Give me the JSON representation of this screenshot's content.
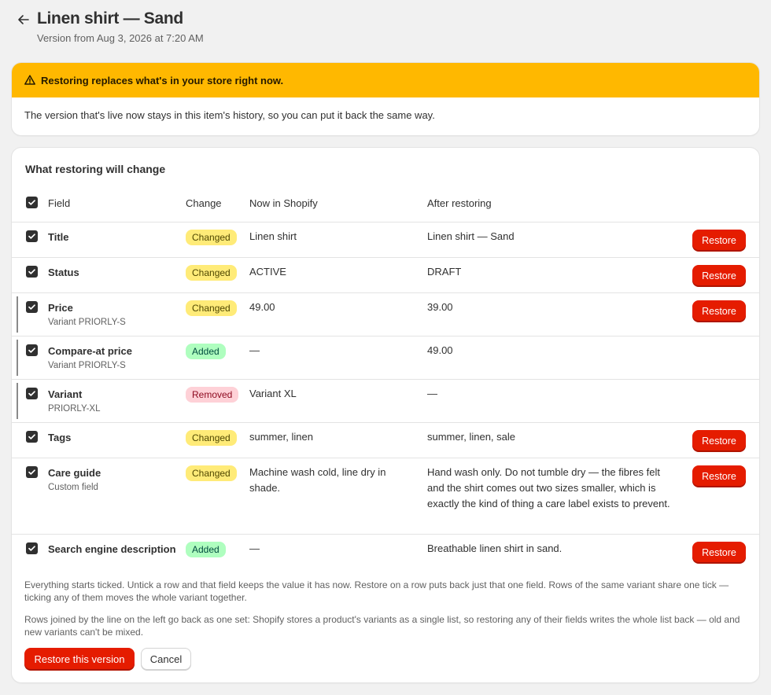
{
  "header": {
    "back_icon": "arrow-left-icon",
    "title": "Linen shirt — Sand",
    "subtitle": "Version from Aug 3, 2026 at 7:20 AM"
  },
  "banner": {
    "icon": "warning-triangle-icon",
    "color": "#ffb800",
    "title": "Restoring replaces what's in your store right now.",
    "body": "The version that's live now stays in this item's history, so you can put it back the same way."
  },
  "changes": {
    "title": "What restoring will change",
    "columns": {
      "field": "Field",
      "change": "Change",
      "now": "Now in Shopify",
      "after": "After restoring"
    },
    "restore_label": "Restore",
    "rows": [
      {
        "field": "Title",
        "sub": "",
        "change": "Changed",
        "now": "Linen shirt",
        "after": "Linen shirt — Sand"
      },
      {
        "field": "Status",
        "sub": "",
        "change": "Changed",
        "now": "ACTIVE",
        "after": "DRAFT"
      },
      {
        "field": "Price",
        "sub": "Variant PRIORLY-S",
        "change": "Changed",
        "now": "49.00",
        "after": "39.00"
      },
      {
        "field": "Compare-at price",
        "sub": "Variant PRIORLY-S",
        "change": "Added",
        "now": "—",
        "after": "49.00"
      },
      {
        "field": "Variant",
        "sub": "PRIORLY-XL",
        "change": "Removed",
        "now": "Variant XL",
        "after": "—"
      },
      {
        "field": "Tags",
        "sub": "",
        "change": "Changed",
        "now": "summer, linen",
        "after": "summer, linen, sale"
      },
      {
        "field": "Care guide",
        "sub": "Custom field",
        "change": "Changed",
        "now": "Machine wash cold, line dry in shade.",
        "after": "Hand wash only. Do not tumble dry — the fibres felt and the shirt comes out two sizes smaller, which is exactly the kind of thing a care label exists to prevent."
      },
      {
        "field": "Search engine description",
        "sub": "",
        "change": "Added",
        "now": "—",
        "after": "Breathable linen shirt in sand."
      }
    ],
    "note_1": "Everything starts ticked. Untick a row and that field keeps the value it has now. Restore on a row puts back just that one field. Rows of the same variant share one tick — ticking any of them moves the whole variant together.",
    "note_2": "Rows joined by the line on the left go back as one set: Shopify stores a product's variants as a single list, so restoring any of their fields writes the whole list back — old and new variants can't be mixed."
  },
  "actions": {
    "primary": "Restore this version",
    "secondary": "Cancel"
  },
  "colors": {
    "critical": "#e51c00",
    "changed_badge": "#ffeb78",
    "added_badge": "#affebf",
    "removed_badge": "#fed1d7"
  }
}
